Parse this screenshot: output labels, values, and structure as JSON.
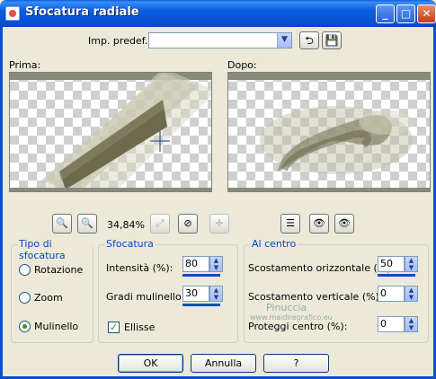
{
  "window": {
    "title": "Sfocatura radiale"
  },
  "toolbar": {
    "preset_label": "Imp. predef.:",
    "preset_value": ""
  },
  "preview": {
    "before_label": "Prima:",
    "after_label": "Dopo:",
    "zoom_value": "34,84%"
  },
  "blur_type": {
    "title": "Tipo di sfocatura",
    "options": [
      "Rotazione",
      "Zoom",
      "Mulinello"
    ],
    "selected": "Mulinello"
  },
  "blur": {
    "title": "Sfocatura",
    "intensity_label": "Intensità (%):",
    "intensity_value": "80",
    "twist_label": "Gradi mulinello:",
    "twist_value": "30",
    "ellipse_label": "Ellisse",
    "ellipse_checked": true
  },
  "center": {
    "title": "Al centro",
    "h_offset_label": "Scostamento orizzontale (%):",
    "h_offset_value": "50",
    "v_offset_label": "Scostamento verticale (%):",
    "v_offset_value": "0",
    "protect_label": "Proteggi centro (%):",
    "protect_value": "0"
  },
  "buttons": {
    "ok": "OK",
    "cancel": "Annulla",
    "help": "?"
  },
  "watermark": {
    "line1": "Pinuccia",
    "line2": "www.maidiregrafico.eu"
  },
  "colors": {
    "titlebar": "#0a4fd0",
    "group_title": "#0046d5",
    "dialog_bg": "#ece9d8"
  }
}
